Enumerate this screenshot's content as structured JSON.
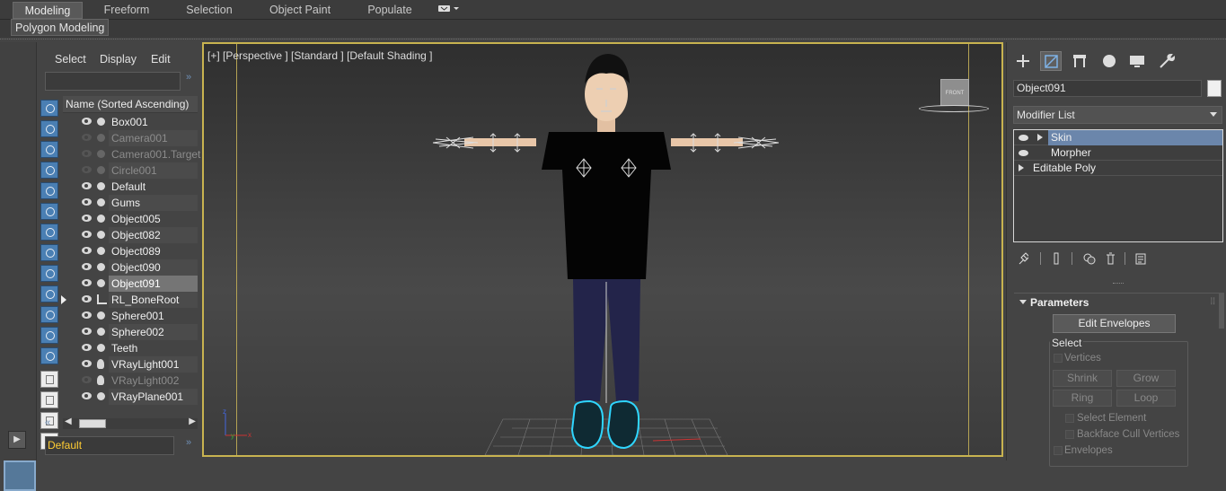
{
  "ribbon": {
    "tabs": [
      {
        "label": "Modeling",
        "active": true
      },
      {
        "label": "Freeform",
        "active": false
      },
      {
        "label": "Selection",
        "active": false
      },
      {
        "label": "Object Paint",
        "active": false
      },
      {
        "label": "Populate",
        "active": false
      }
    ],
    "sub_tab": "Polygon Modeling"
  },
  "explorer": {
    "menu": [
      "Select",
      "Display",
      "Edit"
    ],
    "column_header": "Name (Sorted Ascending)",
    "search_value": "",
    "items": [
      {
        "name": "Box001",
        "hidden": false,
        "type": "geometry"
      },
      {
        "name": "Camera001",
        "hidden": true,
        "type": "camera"
      },
      {
        "name": "Camera001.Target",
        "hidden": true,
        "type": "camera"
      },
      {
        "name": "Circle001",
        "hidden": true,
        "type": "shape"
      },
      {
        "name": "Default",
        "hidden": false,
        "type": "geometry"
      },
      {
        "name": "Gums",
        "hidden": false,
        "type": "geometry"
      },
      {
        "name": "Object005",
        "hidden": false,
        "type": "geometry"
      },
      {
        "name": "Object082",
        "hidden": false,
        "type": "geometry"
      },
      {
        "name": "Object089",
        "hidden": false,
        "type": "geometry"
      },
      {
        "name": "Object090",
        "hidden": false,
        "type": "geometry"
      },
      {
        "name": "Object091",
        "hidden": false,
        "type": "geometry",
        "selected": true
      },
      {
        "name": "RL_BoneRoot",
        "hidden": false,
        "type": "bone",
        "expandable": true
      },
      {
        "name": "Sphere001",
        "hidden": false,
        "type": "geometry"
      },
      {
        "name": "Sphere002",
        "hidden": false,
        "type": "geometry"
      },
      {
        "name": "Teeth",
        "hidden": false,
        "type": "geometry"
      },
      {
        "name": "VRayLight001",
        "hidden": false,
        "type": "light"
      },
      {
        "name": "VRayLight002",
        "hidden": true,
        "type": "light"
      },
      {
        "name": "VRayPlane001",
        "hidden": false,
        "type": "geometry"
      }
    ],
    "layer": "Default"
  },
  "viewport": {
    "label": "[+] [Perspective ] [Standard ] [Default Shading ]",
    "viewcube_face": "FRONT",
    "border_color": "#c8b350"
  },
  "command_panel": {
    "tabs": [
      "create-icon",
      "modify-icon",
      "hierarchy-icon",
      "motion-icon",
      "display-icon",
      "utilities-icon"
    ],
    "object_name": "Object091",
    "modifier_list": "Modifier List",
    "stack": [
      {
        "label": "Skin",
        "selected": true,
        "eye": true
      },
      {
        "label": "Morpher",
        "selected": false,
        "eye": true
      },
      {
        "label": "Editable Poly",
        "selected": false,
        "eye": false
      }
    ],
    "rollout_title": "Parameters",
    "edit_envelopes": "Edit Envelopes",
    "select_group": "Select",
    "vertices": "Vertices",
    "shrink": "Shrink",
    "grow": "Grow",
    "ring": "Ring",
    "loop": "Loop",
    "select_element": "Select Element",
    "backface": "Backface Cull Vertices",
    "envelopes": "Envelopes"
  }
}
